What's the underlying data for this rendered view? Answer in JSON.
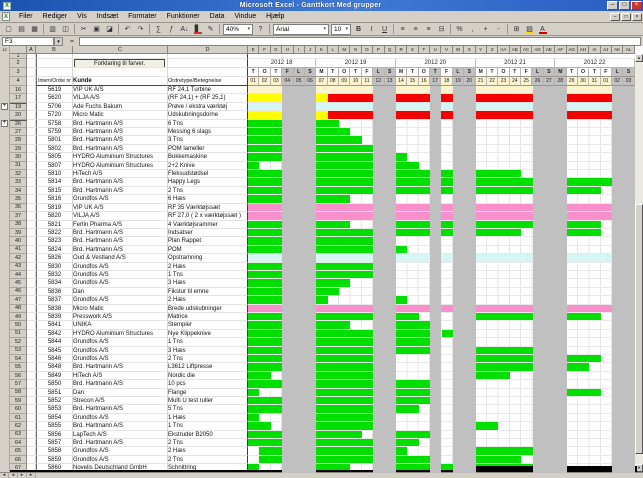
{
  "window": {
    "title": "Microsoft Excel - Ganttkort Med grupper",
    "controls": [
      "–",
      "□",
      "×"
    ]
  },
  "menu": {
    "items": [
      "Filer",
      "Rediger",
      "Vis",
      "Indsæt",
      "Formater",
      "Funktioner",
      "Data",
      "Vindue",
      "Hjælp"
    ]
  },
  "toolbar": {
    "items": [
      {
        "name": "new-button",
        "glyph": "▢"
      },
      {
        "name": "open-button",
        "glyph": "▤"
      },
      {
        "name": "save-button",
        "glyph": "▦"
      },
      {
        "sep": true
      },
      {
        "name": "print-button",
        "glyph": "▥"
      },
      {
        "name": "print-preview-button",
        "glyph": "◫"
      },
      {
        "sep": true
      },
      {
        "name": "cut-button",
        "glyph": "✂"
      },
      {
        "name": "copy-button",
        "glyph": "▣"
      },
      {
        "name": "format-painter-button",
        "glyph": "◪"
      },
      {
        "sep": true
      },
      {
        "name": "undo-button",
        "glyph": "↶"
      },
      {
        "name": "redo-button",
        "glyph": "↷"
      },
      {
        "sep": true
      },
      {
        "name": "autosum-button",
        "glyph": "∑"
      },
      {
        "name": "paste-function-button",
        "glyph": "ƒ"
      },
      {
        "name": "sort-ascending-button",
        "glyph": "A↓"
      },
      {
        "name": "chart-wizard-button",
        "glyph": "▋",
        "accent": "#cc3333"
      },
      {
        "name": "drawing-button",
        "glyph": "✎"
      },
      {
        "sep": true
      },
      {
        "name": "zoom-combo",
        "text": "40%",
        "w": 30
      },
      {
        "name": "help-button",
        "glyph": "?"
      },
      {
        "sep": true
      },
      {
        "name": "font-combo",
        "text": "Arial",
        "w": 56
      },
      {
        "name": "font-size-combo",
        "text": "10",
        "w": 20
      },
      {
        "name": "bold-button",
        "glyph": "B",
        "cls": "bold"
      },
      {
        "name": "italic-button",
        "glyph": "I",
        "cls": "ital"
      },
      {
        "name": "underline-button",
        "glyph": "U",
        "cls": "undl"
      },
      {
        "sep": true
      },
      {
        "name": "align-left-button",
        "glyph": "≡"
      },
      {
        "name": "align-center-button",
        "glyph": "≡"
      },
      {
        "name": "align-right-button",
        "glyph": "≡"
      },
      {
        "name": "merge-center-button",
        "glyph": "⊟"
      },
      {
        "sep": true
      },
      {
        "name": "percent-style-button",
        "glyph": "%"
      },
      {
        "name": "comma-style-button",
        "glyph": ","
      },
      {
        "name": "increase-decimal-button",
        "glyph": "+"
      },
      {
        "name": "decrease-decimal-button",
        "glyph": "-"
      },
      {
        "sep": true
      },
      {
        "name": "borders-button",
        "glyph": "⊞"
      },
      {
        "name": "fill-color-button",
        "glyph": "▨",
        "accent": "#ffd700"
      },
      {
        "name": "font-color-button",
        "glyph": "A",
        "accent": "#cc0000"
      }
    ]
  },
  "formula_bar": {
    "name_box": "F3",
    "equals": "="
  },
  "legend": {
    "note": "Forklaring til farver."
  },
  "table": {
    "headers": {
      "b": "Intern/Ordre nr",
      "c": "Kunde",
      "d": "Ordretype/Betegnelse"
    },
    "column_letters": [
      "A",
      "B",
      "C",
      "D"
    ]
  },
  "timeline": {
    "weeks": [
      {
        "label": "2012 18",
        "days": 6
      },
      {
        "label": "2012 19",
        "days": 7
      },
      {
        "label": "2012 20",
        "days": 7
      },
      {
        "label": "2012 21",
        "days": 7
      },
      {
        "label": "2012 22",
        "days": 7
      }
    ],
    "day_letters": [
      "T",
      "O",
      "T",
      "F",
      "L",
      "S",
      "M",
      "T",
      "O",
      "T",
      "F",
      "L",
      "S",
      "M",
      "T",
      "O",
      "T",
      "F",
      "L",
      "S",
      "M",
      "T",
      "O",
      "T",
      "F",
      "L",
      "S",
      "M",
      "T",
      "O",
      "T",
      "F",
      "L",
      "S"
    ],
    "day_numbers": [
      "01",
      "02",
      "03",
      "04",
      "05",
      "06",
      "07",
      "08",
      "09",
      "10",
      "11",
      "12",
      "13",
      "14",
      "15",
      "16",
      "17",
      "18",
      "19",
      "20",
      "21",
      "22",
      "23",
      "24",
      "25",
      "26",
      "27",
      "28",
      "29",
      "30",
      "31",
      "01",
      "02",
      "03"
    ],
    "gray_days": [
      4,
      5,
      6,
      12,
      13,
      17,
      19,
      20,
      26,
      27,
      28,
      33,
      34
    ],
    "column_letters": [
      "E",
      "F",
      "G",
      "H",
      "I",
      "J",
      "K",
      "L",
      "M",
      "N",
      "O",
      "P",
      "Q",
      "R",
      "S",
      "T",
      "U",
      "V",
      "W",
      "X",
      "Y",
      "Z",
      "AA",
      "AB",
      "AC",
      "AD",
      "AE",
      "AF",
      "AG",
      "AH",
      "AI",
      "AJ",
      "AK",
      "AL"
    ]
  },
  "outline": {
    "plus_rows": [
      19,
      26
    ],
    "level_buttons": [
      "1",
      "2"
    ]
  },
  "colors": {
    "green": "#00df00",
    "red": "#f40000",
    "yellow": "#ffff00",
    "pink": "#f98fcb",
    "cyan": "#d6f6f6",
    "cream": "#fdf3cf",
    "nonwork_gray": "#c0c0c0"
  },
  "rows": [
    {
      "n": 16,
      "id": "5619",
      "customer": "VIP UK A/S",
      "desc": "RF 24,1 Turbine",
      "fill": "cream",
      "bars": []
    },
    {
      "n": 17,
      "id": "5620",
      "customer": "VILJA A/S",
      "desc": "(RF 24,1) + (RF 25,1)",
      "bars": [
        [
          "y",
          1,
          3
        ],
        [
          "y",
          7,
          7
        ],
        [
          "r",
          8,
          32
        ]
      ]
    },
    {
      "n": 19,
      "id": "5706",
      "customer": "Ade Fuchs Bakum",
      "desc": "Prøve / ekstra værktøj",
      "fill": "cyan",
      "bars": []
    },
    {
      "n": 20,
      "id": "5720",
      "customer": "Micro Matic",
      "desc": "Udskubningsdorne",
      "bars": [
        [
          "y",
          1,
          3
        ],
        [
          "y",
          7,
          7
        ],
        [
          "r",
          8,
          32
        ]
      ]
    },
    {
      "n": 26,
      "id": "5758",
      "customer": "Brd. Hartmann A/S",
      "desc": "6 Tns",
      "bars": [
        [
          "g",
          1,
          8
        ]
      ]
    },
    {
      "n": 27,
      "id": "5759",
      "customer": "Brd. Hartmann A/S",
      "desc": "Messing 6 slags",
      "bars": [
        [
          "g",
          1,
          9
        ]
      ]
    },
    {
      "n": 28,
      "id": "5801",
      "customer": "Brd. Hartmann A/S",
      "desc": "3 Tns",
      "bars": [
        [
          "g",
          1,
          10
        ]
      ]
    },
    {
      "n": 29,
      "id": "5802",
      "customer": "Brd. Hartmann A/S",
      "desc": "POM lameller",
      "bars": [
        [
          "g",
          1,
          11
        ]
      ]
    },
    {
      "n": 30,
      "id": "5805",
      "customer": "HYDRO Aluminium Structures",
      "desc": "Bukkemaskine",
      "bars": [
        [
          "g",
          1,
          14
        ]
      ]
    },
    {
      "n": 31,
      "id": "5807",
      "customer": "HYDRO Aluminium Structures",
      "desc": "2+2 Knive",
      "bars": [
        [
          "g",
          1,
          1
        ],
        [
          "g",
          7,
          15
        ]
      ]
    },
    {
      "n": 32,
      "id": "5810",
      "customer": "HiTech A/S",
      "desc": "Fleksudstødsel",
      "bars": [
        [
          "g",
          1,
          24
        ]
      ]
    },
    {
      "n": 33,
      "id": "5814",
      "customer": "Brd. Hartmann A/S",
      "desc": "Happy Legs",
      "bars": [
        [
          "g",
          1,
          32
        ]
      ]
    },
    {
      "n": 34,
      "id": "5815",
      "customer": "Brd. Hartmann A/S",
      "desc": "2 Tns",
      "bars": [
        [
          "g",
          1,
          31
        ]
      ]
    },
    {
      "n": 35,
      "id": "5816",
      "customer": "Grundfos A/S",
      "desc": "6 Hæs",
      "bars": [
        [
          "g",
          1,
          9
        ]
      ]
    },
    {
      "n": 36,
      "id": "5819",
      "customer": "VIP UK A/S",
      "desc": "RF 35  Værktøjssæt",
      "fill": "pink",
      "bars": []
    },
    {
      "n": 37,
      "id": "5820",
      "customer": "VILJA A/S",
      "desc": "RF 27,0 ( 2 x værktøjssæt )",
      "fill": "pink",
      "bars": []
    },
    {
      "n": 38,
      "id": "5821",
      "customer": "Fertin Pharma A/S",
      "desc": "4 Værktøjsrammer",
      "bars": [
        [
          "g",
          1,
          9
        ],
        [
          "g",
          14,
          31
        ]
      ]
    },
    {
      "n": 39,
      "id": "5822",
      "customer": "Brd. Hartmann A/S",
      "desc": "Indsatser",
      "bars": [
        [
          "g",
          1,
          24
        ],
        [
          "g",
          29,
          31
        ]
      ]
    },
    {
      "n": 40,
      "id": "5823",
      "customer": "Brd. Hartmann A/S",
      "desc": "Plan Rappet",
      "bars": [
        [
          "g",
          1,
          11
        ]
      ]
    },
    {
      "n": 41,
      "id": "5824",
      "customer": "Brd. Hartmann A/S",
      "desc": "POM",
      "bars": [
        [
          "g",
          1,
          14
        ]
      ]
    },
    {
      "n": 42,
      "id": "5826",
      "customer": "Oud & Vestland A/S",
      "desc": "Opstramning",
      "fill": "cyan",
      "bars": []
    },
    {
      "n": 43,
      "id": "5830",
      "customer": "Grundfos A/S",
      "desc": "2 Hæs",
      "bars": [
        [
          "g",
          1,
          11
        ]
      ]
    },
    {
      "n": 44,
      "id": "5832",
      "customer": "Grundfos A/S",
      "desc": "1 Tns",
      "bars": [
        [
          "g",
          1,
          11
        ]
      ]
    },
    {
      "n": 45,
      "id": "5834",
      "customer": "Grundfos A/S",
      "desc": "3 Hæs",
      "bars": [
        [
          "g",
          1,
          9
        ]
      ]
    },
    {
      "n": 46,
      "id": "5836",
      "customer": "Dan",
      "desc": "Fikstur til emne",
      "bars": [
        [
          "g",
          1,
          8
        ]
      ]
    },
    {
      "n": 47,
      "id": "5837",
      "customer": "Grundfos A/S",
      "desc": "2 Hæs",
      "bars": [
        [
          "g",
          1,
          7
        ],
        [
          "g",
          14,
          14
        ]
      ]
    },
    {
      "n": 48,
      "id": "5838",
      "customer": "Micro Matic",
      "desc": "Brede udskubninger",
      "fill": "pink",
      "bars": []
    },
    {
      "n": 49,
      "id": "5839",
      "customer": "Presswork A/S",
      "desc": "Matrice",
      "bars": [
        [
          "g",
          1,
          15
        ],
        [
          "g",
          21,
          25
        ],
        [
          "g",
          29,
          31
        ]
      ]
    },
    {
      "n": 50,
      "id": "5841",
      "customer": "UNIKA",
      "desc": "Stempler",
      "bars": [
        [
          "g",
          1,
          9
        ],
        [
          "g",
          14,
          16
        ]
      ]
    },
    {
      "n": 51,
      "id": "5842",
      "customer": "HYDRO Aluminium Structures",
      "desc": "Nye Klippeknive",
      "bars": [
        [
          "g",
          1,
          16
        ],
        [
          "g",
          18,
          18
        ]
      ]
    },
    {
      "n": 52,
      "id": "5844",
      "customer": "Grundfos A/S",
      "desc": "1 Tns",
      "bars": [
        [
          "g",
          1,
          16
        ]
      ]
    },
    {
      "n": 53,
      "id": "5845",
      "customer": "Grundfos A/S",
      "desc": "3 Hæs",
      "bars": [
        [
          "g",
          1,
          16
        ],
        [
          "g",
          21,
          25
        ]
      ]
    },
    {
      "n": 54,
      "id": "5846",
      "customer": "Grundfos A/S",
      "desc": "2 Tns",
      "bars": [
        [
          "g",
          1,
          11
        ],
        [
          "g",
          21,
          25
        ],
        [
          "g",
          29,
          31
        ]
      ]
    },
    {
      "n": 55,
      "id": "5848",
      "customer": "Brd. Hartmann A/S",
      "desc": "L3612 Liftpresse",
      "bars": [
        [
          "g",
          1,
          11
        ],
        [
          "g",
          21,
          25
        ],
        [
          "g",
          29,
          30
        ]
      ]
    },
    {
      "n": 56,
      "id": "5849",
      "customer": "HiTech A/S",
      "desc": "Nordic die",
      "bars": [
        [
          "g",
          1,
          2
        ],
        [
          "g",
          7,
          11
        ],
        [
          "g",
          21,
          23
        ]
      ]
    },
    {
      "n": 57,
      "id": "5850",
      "customer": "Brd. Hartmann A/S",
      "desc": "10 pcs",
      "bars": [
        [
          "g",
          1,
          11
        ],
        [
          "g",
          14,
          16
        ]
      ]
    },
    {
      "n": 58,
      "id": "5851",
      "customer": "Dan",
      "desc": "Flange",
      "bars": [
        [
          "g",
          1,
          1
        ],
        [
          "g",
          7,
          16
        ],
        [
          "g",
          29,
          31
        ]
      ]
    },
    {
      "n": 59,
      "id": "5852",
      "customer": "Strecon A/S",
      "desc": "Multi U test ruller",
      "bars": [
        [
          "g",
          1,
          3
        ],
        [
          "g",
          7,
          11
        ],
        [
          "g",
          14,
          16
        ]
      ]
    },
    {
      "n": 60,
      "id": "5853",
      "customer": "Brd. Hartmann A/S",
      "desc": "5 Tns",
      "bars": [
        [
          "g",
          1,
          11
        ],
        [
          "g",
          14,
          15
        ]
      ]
    },
    {
      "n": 61,
      "id": "5854",
      "customer": "Grundfos A/S",
      "desc": "1 Hæs",
      "bars": [
        [
          "g",
          1,
          1
        ],
        [
          "g",
          7,
          11
        ]
      ]
    },
    {
      "n": 62,
      "id": "5855",
      "customer": "Brd. Hartmann A/S",
      "desc": "1 Tns",
      "bars": [
        [
          "g",
          1,
          2
        ],
        [
          "g",
          7,
          11
        ],
        [
          "g",
          21,
          22
        ]
      ]
    },
    {
      "n": 63,
      "id": "5856",
      "customer": "LapTech A/S",
      "desc": "Ekstruder B2050",
      "bars": [
        [
          "g",
          1,
          3
        ],
        [
          "g",
          7,
          10
        ],
        [
          "g",
          14,
          16
        ]
      ]
    },
    {
      "n": 64,
      "id": "5857",
      "customer": "Brd. Hartmann A/S",
      "desc": "2 Tns",
      "bars": [
        [
          "g",
          1,
          3
        ],
        [
          "g",
          7,
          11
        ],
        [
          "g",
          14,
          15
        ]
      ]
    },
    {
      "n": 65,
      "id": "5858",
      "customer": "Grundfos A/S",
      "desc": "2 Hæs",
      "bars": [
        [
          "g",
          2,
          3
        ],
        [
          "g",
          7,
          11
        ],
        [
          "g",
          14,
          14
        ],
        [
          "g",
          21,
          25
        ]
      ]
    },
    {
      "n": 66,
      "id": "5859",
      "customer": "Grundfos A/S",
      "desc": "2 Tns",
      "bars": [
        [
          "g",
          2,
          3
        ],
        [
          "g",
          7,
          11
        ],
        [
          "g",
          14,
          16
        ],
        [
          "g",
          21,
          24
        ]
      ]
    },
    {
      "n": 67,
      "id": "5860",
      "customer": "Novelis Deutschland GmbH",
      "desc": "Schnittring",
      "bars": [
        [
          "g",
          1,
          1
        ],
        [
          "g",
          7,
          9
        ],
        [
          "g",
          14,
          18
        ],
        [
          "g",
          21,
          25
        ]
      ]
    }
  ],
  "tab_strip": {
    "arrows": [
      "◂",
      "◂",
      "▸",
      "▸"
    ]
  }
}
